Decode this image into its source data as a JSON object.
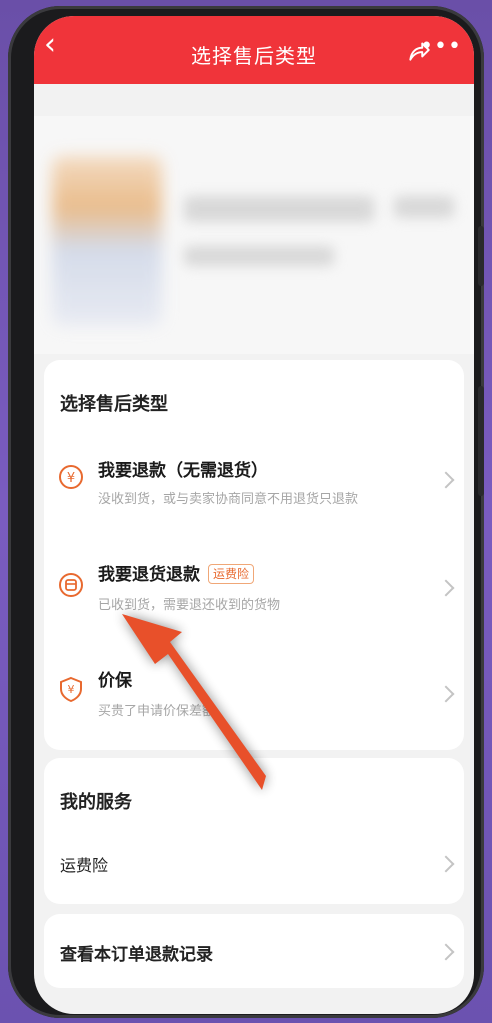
{
  "header": {
    "title": "选择售后类型",
    "back_icon": "chevron-left-icon",
    "share_icon": "share-icon",
    "more_icon": "more-icon",
    "more_glyph": "•••"
  },
  "section_type": {
    "title": "选择售后类型",
    "options": [
      {
        "name": "我要退款（无需退货）",
        "desc": "没收到货，或与卖家协商同意不用退货只退款",
        "icon": "yen-refund-icon"
      },
      {
        "name": "我要退货退款",
        "tag": "运费险",
        "desc": "已收到货，需要退还收到的货物",
        "icon": "return-box-icon"
      },
      {
        "name": "价保",
        "desc": "买贵了申请价保差额",
        "icon": "price-protect-icon"
      }
    ]
  },
  "section_service": {
    "title": "我的服务",
    "items": [
      {
        "label": "运费险"
      }
    ]
  },
  "records_link": {
    "label": "查看本订单退款记录"
  },
  "colors": {
    "header": "#f0343a",
    "accent_orange": "#e8692f",
    "annotation_arrow": "#e8502a"
  }
}
